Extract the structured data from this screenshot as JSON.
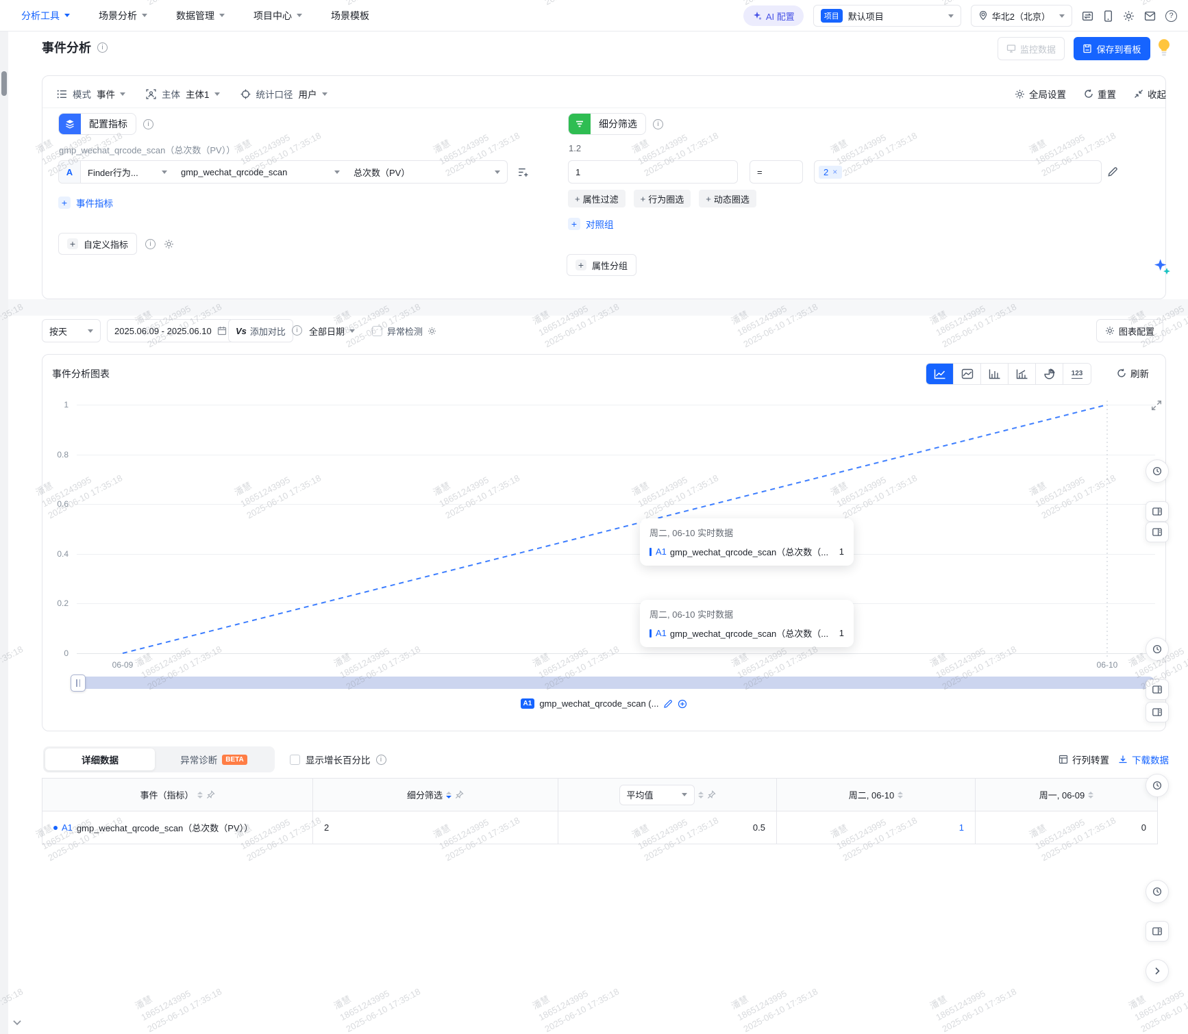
{
  "watermark": {
    "line1": "潘慧",
    "line2": "18651243995",
    "line3": "2025-06-10 17:35:18"
  },
  "topnav": {
    "items": [
      {
        "label": "分析工具"
      },
      {
        "label": "场景分析"
      },
      {
        "label": "数据管理"
      },
      {
        "label": "项目中心"
      },
      {
        "label": "场景模板"
      }
    ],
    "ai_config": "AI 配置",
    "project_badge": "项目",
    "project_name": "默认项目",
    "region": "华北2（北京）"
  },
  "header": {
    "title": "事件分析",
    "monitor": "监控数据",
    "save": "保存到看板"
  },
  "modebar": {
    "mode_label": "模式",
    "mode_value": "事件",
    "subject_label": "主体",
    "subject_value": "主体1",
    "caliber_label": "统计口径",
    "caliber_value": "用户",
    "global": "全局设置",
    "reset": "重置",
    "collapse": "收起"
  },
  "metrics": {
    "section": "配置指标",
    "caption": "gmp_wechat_qrcode_scan（总次数（PV））",
    "badge": "A",
    "behavior_select": "Finder行为...",
    "event_select": "gmp_wechat_qrcode_scan",
    "agg_select": "总次数（PV）",
    "add_event": "事件指标",
    "add_custom": "自定义指标"
  },
  "filters": {
    "section": "细分筛选",
    "index": "1.2",
    "field": "1",
    "operator": "=",
    "tag": "2",
    "chip1": "属性过滤",
    "chip2": "行为圈选",
    "chip3": "动态圈选",
    "add_compare": "对照组",
    "add_group": "属性分组"
  },
  "daterow": {
    "granularity": "按天",
    "range": "2025.06.09 - 2025.06.10",
    "vs": "Vs",
    "compare": "添加对比",
    "all_dates": "全部日期",
    "anomaly": "异常检测",
    "chart_config": "图表配置"
  },
  "chart": {
    "title": "事件分析图表",
    "refresh": "刷新",
    "legend_badge": "A1",
    "legend_label": "gmp_wechat_qrcode_scan (...",
    "tooltips": [
      {
        "title": "周二, 06-10 实时数据",
        "series": "A1",
        "name": "gmp_wechat_qrcode_scan（总次数（...",
        "value": "1"
      },
      {
        "title": "周二, 06-10 实时数据",
        "series": "A1",
        "name": "gmp_wechat_qrcode_scan（总次数（...",
        "value": "1"
      }
    ]
  },
  "chart_data": {
    "type": "line",
    "x": [
      "06-09",
      "06-10"
    ],
    "series": [
      {
        "name": "A1 gmp_wechat_qrcode_scan（总次数（PV））",
        "values": [
          0,
          1
        ]
      }
    ],
    "ylim": [
      0,
      1
    ],
    "yticks": [
      0,
      0.2,
      0.4,
      0.6,
      0.8,
      1
    ],
    "line_color": "#3d7eff",
    "line_style": "dashed",
    "grid": true,
    "legend_position": "bottom"
  },
  "tabsrow": {
    "detail": "详细数据",
    "diagnosis": "异常诊断",
    "beta": "BETA",
    "growth": "显示增长百分比",
    "transpose": "行列转置",
    "download": "下载数据"
  },
  "table": {
    "col1": "事件（指标）",
    "col2": "细分筛选",
    "col3_select": "平均值",
    "col4": "周二, 06-10",
    "col5": "周一, 06-09",
    "row": {
      "series": "A1",
      "name": "gmp_wechat_qrcode_scan（总次数（PV））",
      "filter_value": "2",
      "avg": "0.5",
      "tue": "1",
      "mon": "0"
    }
  },
  "colors": {
    "primary": "#1664ff",
    "green": "#2fbd52",
    "beta": "#ff7d45",
    "line": "#3d7eff",
    "scrollbar": "#ccd5ef"
  }
}
